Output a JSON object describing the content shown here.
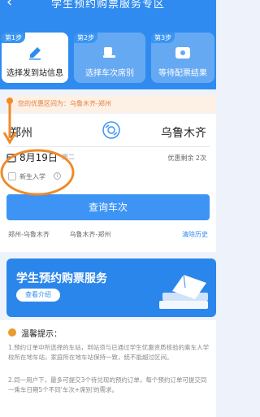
{
  "header": {
    "back_icon": "chevron-left-icon",
    "title": "学生预约购票服务专区"
  },
  "steps": [
    {
      "tag": "第1步",
      "label": "选择发到站信息",
      "icon": "pen-icon"
    },
    {
      "tag": "第2步",
      "label": "选择车次席别",
      "icon": "seat-icon"
    },
    {
      "tag": "第3步",
      "label": "等待配票结果",
      "icon": "ticket-icon"
    }
  ],
  "notice": {
    "text": "您的优惠区间为：乌鲁木齐-郑州"
  },
  "search": {
    "from": "郑州",
    "to": "乌鲁木齐",
    "date": "8月19日",
    "weekday": "周二",
    "quota": "优惠剩余",
    "quota_count": "2次",
    "new_student": "新生入学",
    "query_button": "查询车次"
  },
  "history": {
    "items": [
      "郑州-乌鲁木齐",
      "乌鲁木齐-郑州"
    ],
    "clear": "清除历史"
  },
  "banner": {
    "title": "学生预约购票服务",
    "button": "查看介绍"
  },
  "tips": {
    "title": "温馨提示：",
    "p1": "1.预约订单中所选择的车站，到站须与已通过学生优惠资质核验的乘车人学校所在地车站，家庭所在地车站保持一致，统不能超过区间。",
    "p2": "2.同一用户下，最多可提交3个待兑现的预约订单，每个预约订单可提交同一乘车日期5个不同'车次+席别'的需求。"
  },
  "colors": {
    "primary": "#2f8bf0",
    "button": "#3d94f5",
    "notice_text": "#e87d3b",
    "annotation": "#f08a2a"
  }
}
